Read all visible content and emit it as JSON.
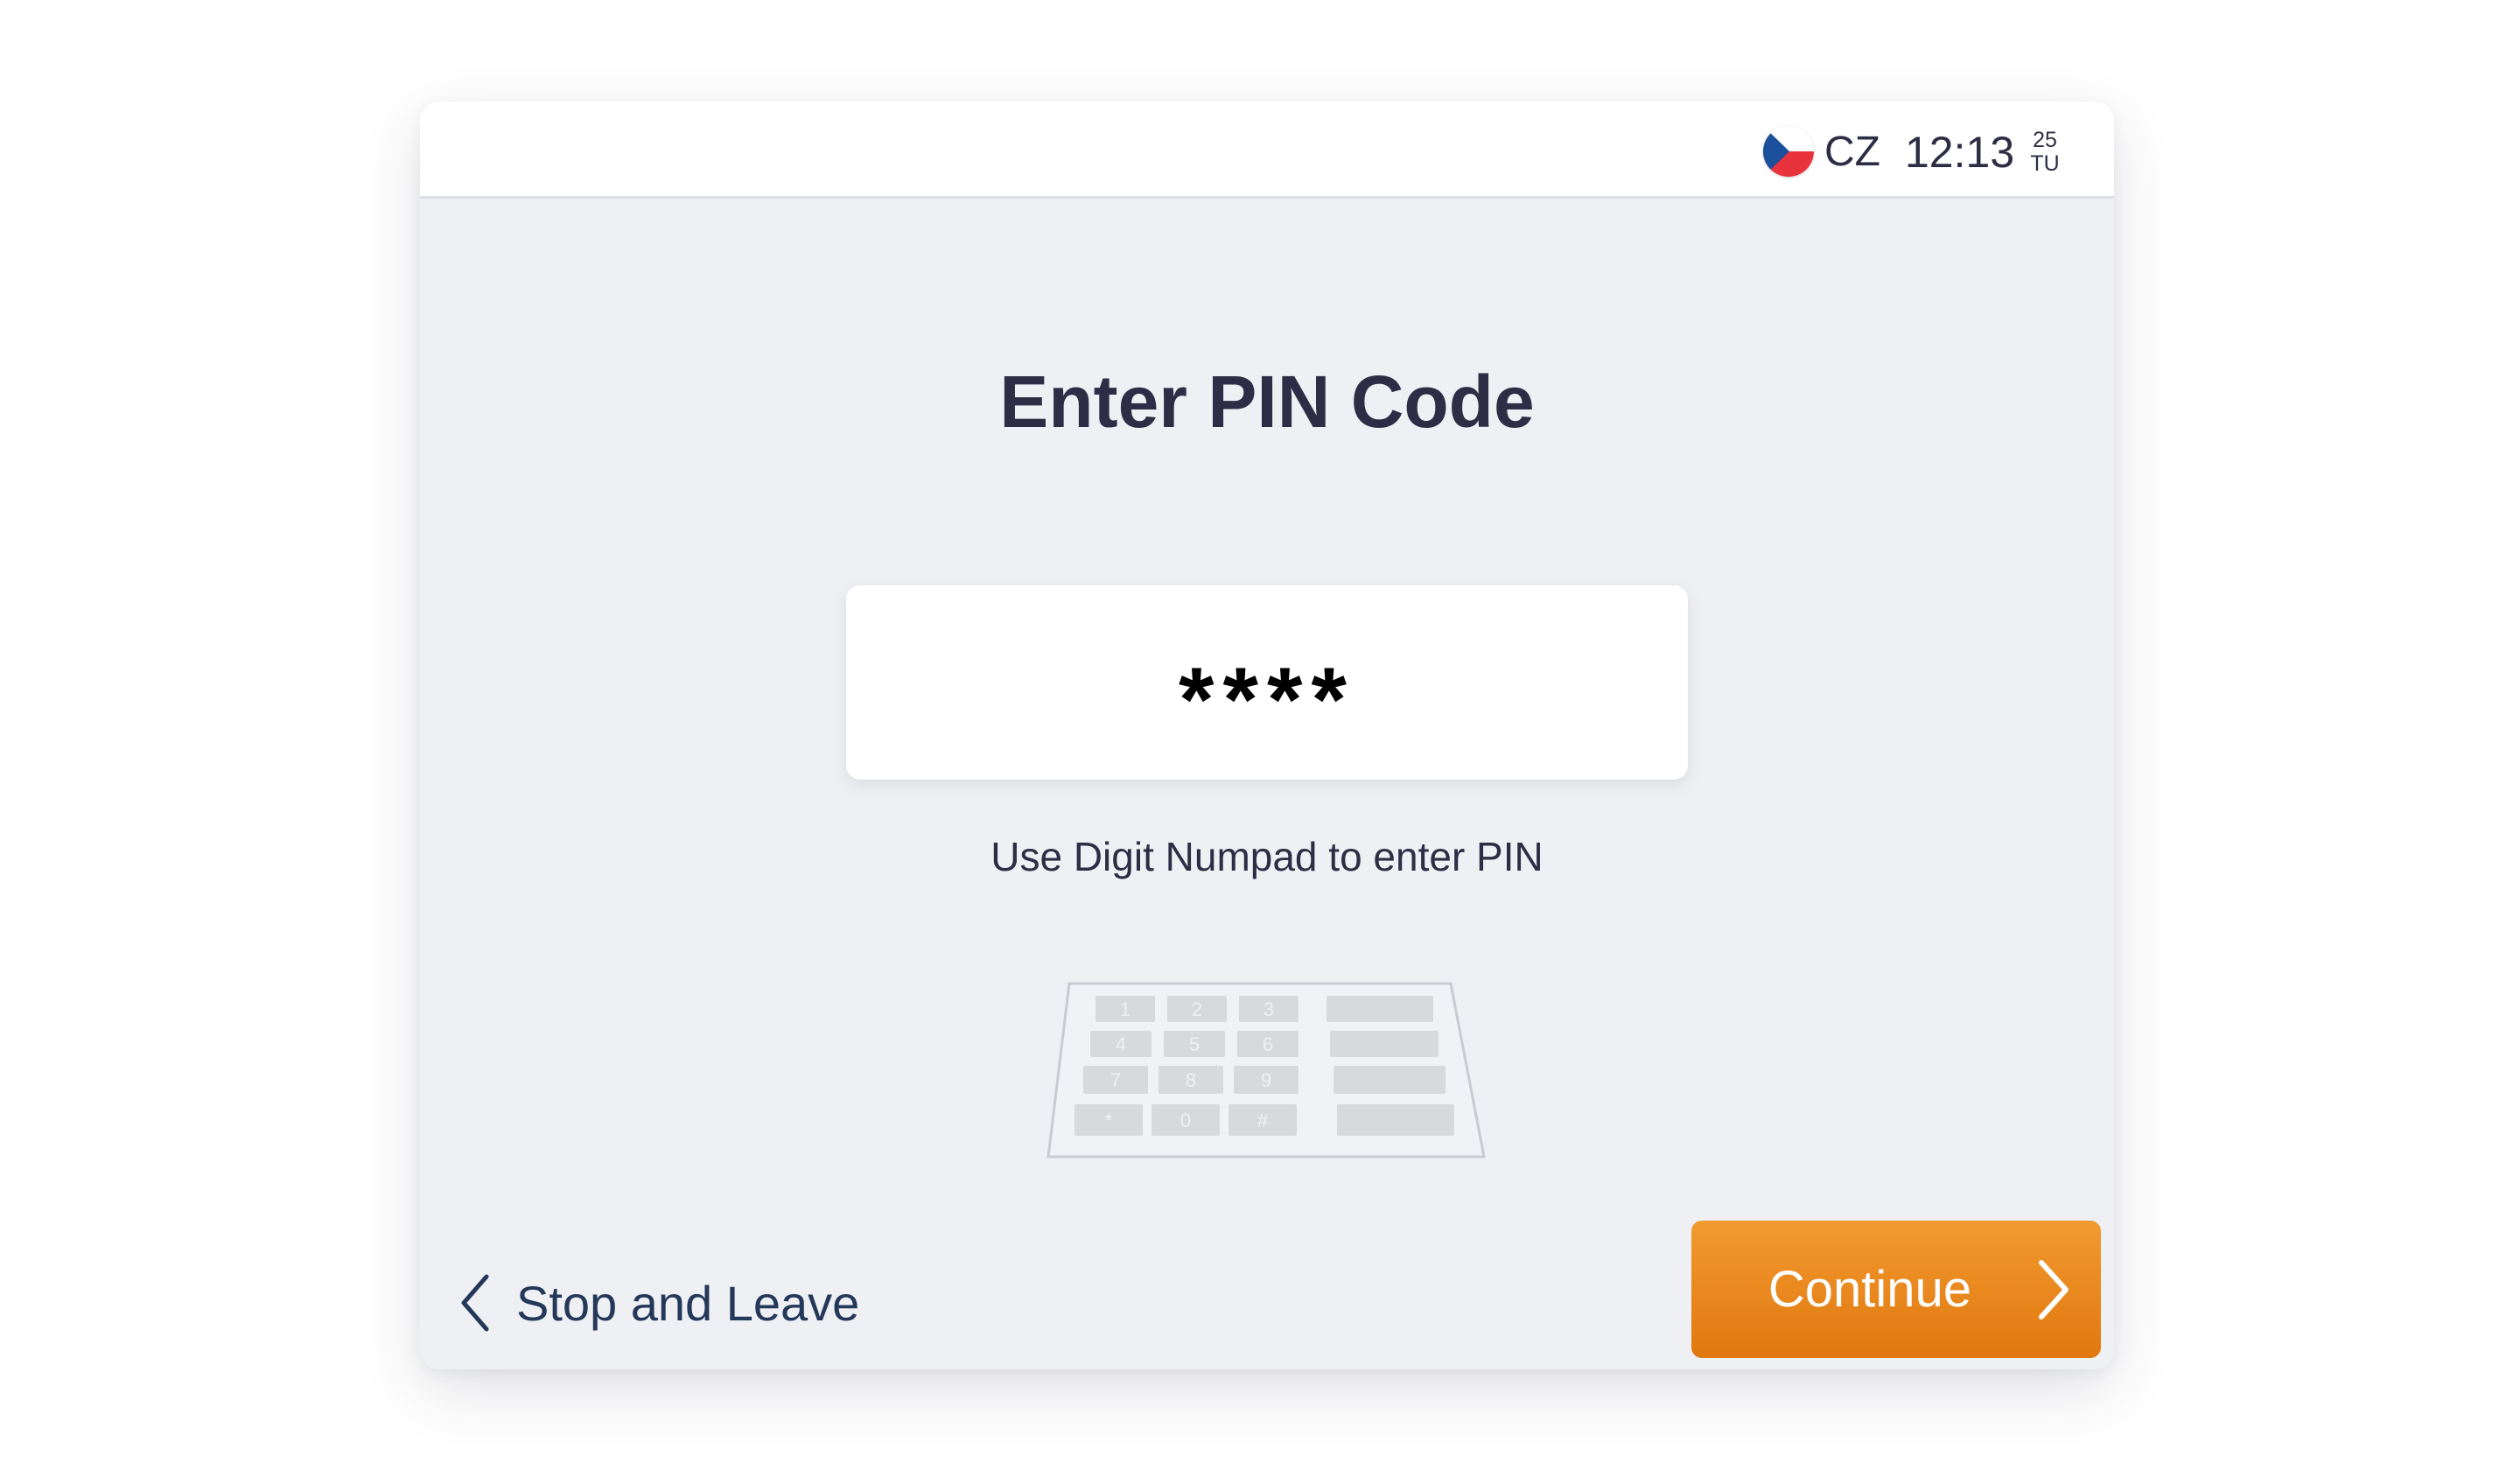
{
  "status_bar": {
    "language_code": "CZ",
    "flag_icon": "czech-flag-icon",
    "time": "12:13",
    "date_day": "25",
    "date_weekday": "TU"
  },
  "main": {
    "title": "Enter PIN Code",
    "pin_masked_value": "****",
    "hint": "Use Digit Numpad to enter PIN",
    "numpad_illustration": {
      "icon": "numpad-icon",
      "keys": [
        "1",
        "2",
        "3",
        "4",
        "5",
        "6",
        "7",
        "8",
        "9",
        "*",
        "0",
        "#"
      ]
    }
  },
  "footer": {
    "back_label": "Stop and Leave",
    "back_icon": "chevron-left-icon",
    "continue_label": "Continue",
    "continue_icon": "chevron-right-icon"
  },
  "colors": {
    "background": "#eff0f3",
    "text_primary": "#2d2e45",
    "back_text": "#24385a",
    "accent_orange": "#ec8a20"
  }
}
